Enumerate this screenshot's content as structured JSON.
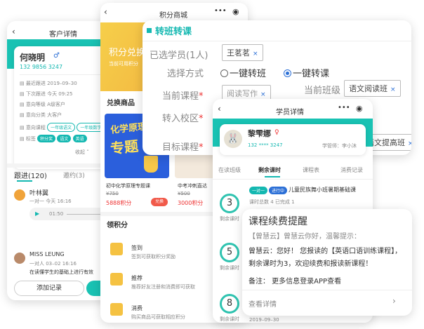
{
  "client": {
    "nav_title": "客户详情",
    "name": "何晓明",
    "phone": "132 9856 3247",
    "rows": [
      {
        "label": "最近跟进",
        "value": "2019–09–30"
      },
      {
        "label": "下次跟进",
        "value": "今天 09:25"
      },
      {
        "label": "意向等级",
        "value": "A级客户"
      },
      {
        "label": "意向分类",
        "value": "大客户"
      },
      {
        "label": "意向课程"
      },
      {
        "label": "标签"
      }
    ],
    "course_tags": [
      "一年级语文",
      "一年级数学"
    ],
    "label_tags": [
      "积分奖",
      "语文",
      "英语"
    ],
    "collapse": "收起",
    "tab_follow": "跟进(120)",
    "tab_invite": "邀约(3)",
    "follow1": {
      "name": "叶林翼",
      "meta": "一对一  今天 16:16",
      "audio_time": "01:50"
    },
    "follow2": {
      "name": "MISS LEUNG",
      "meta": "一对人  03–02 16:16",
      "text": "在读懂学生的基础上进行有效"
    },
    "btn_add": "添加记录"
  },
  "mall": {
    "nav_title": "积分商城",
    "banner_title": "积分兑换",
    "banner_sub": "当前可用积分",
    "section_exchange": "兑换商品",
    "p1": {
      "banner_a": "化学原理",
      "banner_b": "专题",
      "name": "初中化学原理专题课",
      "old": "¥750",
      "points": "5888积分",
      "btn": "兑换"
    },
    "p2": {
      "name": "中考冲刺直达",
      "old": "¥500",
      "points": "3000积分"
    },
    "section_get": "领积分",
    "tasks": [
      {
        "title": "签到",
        "desc": "签到可获取积分奖励"
      },
      {
        "title": "推荐",
        "desc": "推荐好友注册和消费即可获取"
      },
      {
        "title": "消费",
        "desc": "购买商品可获取相应积分"
      }
    ]
  },
  "transfer": {
    "title": "转班转课",
    "selected_label": "已选学员(1人)",
    "selected_student": "王茗茗",
    "method_label": "选择方式",
    "opt1": "一键转班",
    "opt2": "一键转课",
    "course_label": "当前课程",
    "course_value": "阅读写作",
    "class_label": "当前班级",
    "class_value": "语文阅读班",
    "campus_label": "转入校区",
    "target_label": "目标课程",
    "target_value": "语文提高班",
    "required": "*",
    "close": "×"
  },
  "student": {
    "nav_title": "学员详情",
    "name": "黎雫娜",
    "gender": "♀",
    "phone": "132 **** 3247",
    "manager": "学管师：李小沐",
    "tabs": [
      "在读班级",
      "剩余课时",
      "课程表",
      "消费记录"
    ],
    "rows": [
      {
        "remain": "3",
        "label": "剩余课时"
      },
      {
        "remain": "5",
        "label": "剩余课时"
      },
      {
        "remain": "8",
        "label": "剩余课时"
      }
    ],
    "class_type": "一对一",
    "class_status": "进行中",
    "class_name": "儿童民族舞小班暑期基础课",
    "class_meta": "课时总数 4    已完成 1",
    "footer_date": "2019–09–30"
  },
  "reminder": {
    "title": "课程续费提醒",
    "from": "【曾慧云】曾慧云你好，温馨提示：",
    "body": "曾慧云：您好！ 您报读的【英语口语训练课程】，剩余课时为3，欢迎续费和报读新课程！",
    "note": "备注：   更多信息登录APP查看",
    "link": "查看详情"
  },
  "colors": {
    "teal": "#14b8b1",
    "blue": "#2b6fd6",
    "red": "#e33"
  }
}
